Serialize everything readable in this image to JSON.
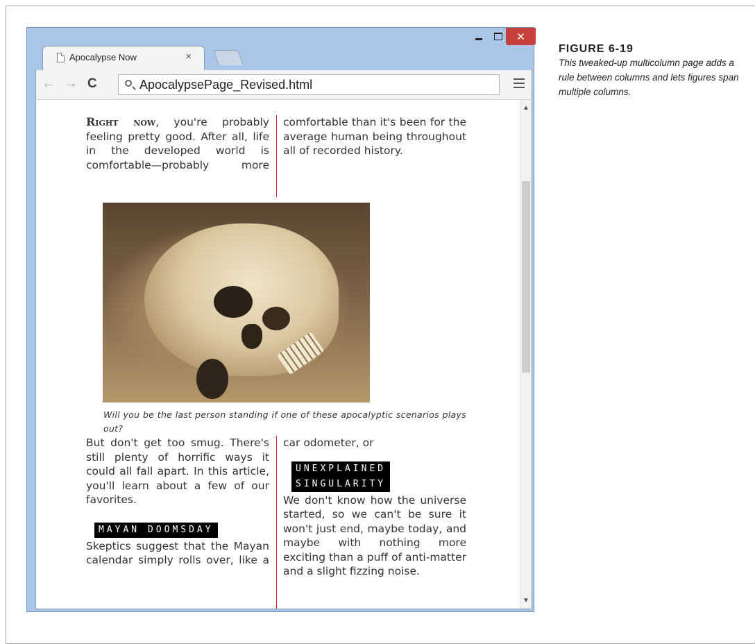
{
  "browser": {
    "tab_title": "Apocalypse Now",
    "tab_close": "×",
    "url": "ApocalypsePage_Revised.html",
    "close_glyph": "✕"
  },
  "article": {
    "p1_lead": "Right now",
    "p1_rest": ", you're probably feeling pretty good. After all, life in the developed world is comfortable—probably more comfortable than it's been for the average human being throughout all of recorded history.",
    "figure_caption": "Will you be the last person standing if one of these apocalyptic scenarios plays out?",
    "p2": "But don't get too smug. There's still plenty of horrific ways it could all fall apart. In this article, you'll learn about a few of our favorites.",
    "heading1": "MAYAN DOOMSDAY",
    "p3": "Skeptics suggest that the Mayan calendar simply rolls over, like a car odometer, or",
    "heading2_line1": "UNEXPLAINED",
    "heading2_line2": "SINGULARITY",
    "p4": "We don't know how the universe started, so we can't be sure it won't just end, maybe today, and maybe with nothing more exciting than a puff of anti-matter and a slight fizzing noise."
  },
  "figure": {
    "label": "FIGURE 6-19",
    "caption": "This tweaked-up multicolumn page adds a rule between columns and lets figures span multiple columns."
  }
}
